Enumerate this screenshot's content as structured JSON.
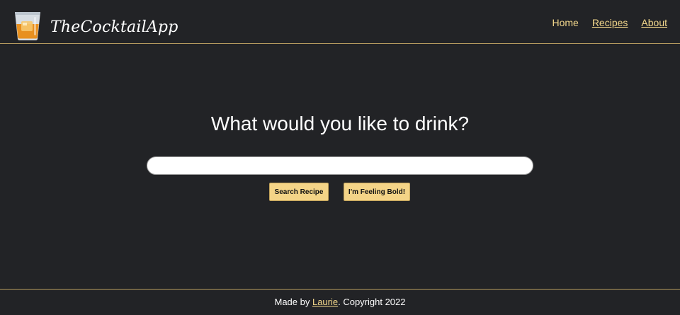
{
  "header": {
    "brand_name": "TheCocktailApp",
    "logo_icon": "whiskey-glass-icon",
    "nav": [
      {
        "label": "Home"
      },
      {
        "label": "Recipes"
      },
      {
        "label": "About"
      }
    ]
  },
  "main": {
    "headline": "What would you like to drink?",
    "search": {
      "value": "",
      "placeholder": ""
    },
    "search_button_label": "Search Recipe",
    "bold_button_label": "I'm Feeling Bold!"
  },
  "footer": {
    "prefix": "Made by ",
    "author": "Laurie",
    "suffix": ". Copyright 2022"
  },
  "colors": {
    "background": "#222326",
    "accent": "#f4d88c",
    "button": "#f4d487",
    "divider": "#b59a5e"
  }
}
